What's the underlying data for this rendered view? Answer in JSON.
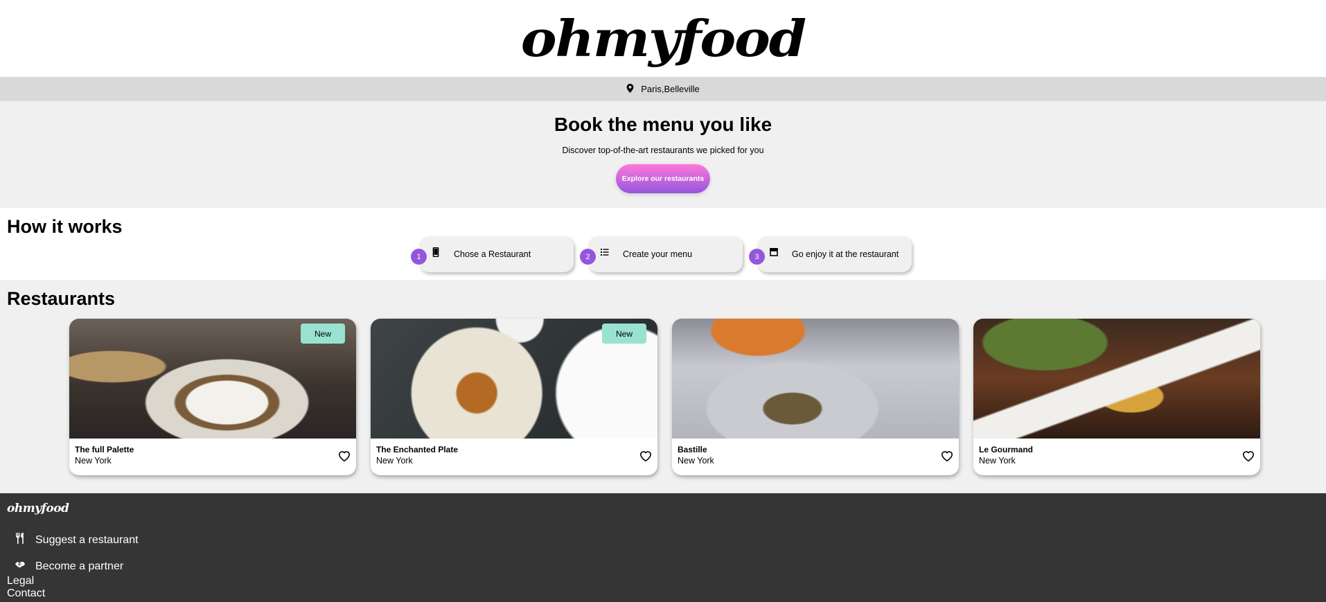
{
  "header": {
    "logo": "ohmyfood"
  },
  "location": {
    "icon": "map-pin-icon",
    "text": "Paris,Belleville"
  },
  "hero": {
    "title": "Book the menu you like",
    "subtitle": "Discover top-of-the-art restaurants we picked for you",
    "cta_label": "Explore our restaurants"
  },
  "how_it_works": {
    "title": "How it works",
    "steps": [
      {
        "number": "1",
        "icon": "smartphone-icon",
        "label": "Chose a Restaurant"
      },
      {
        "number": "2",
        "icon": "list-icon",
        "label": "Create your menu"
      },
      {
        "number": "3",
        "icon": "store-icon",
        "label": "Go enjoy it at the restaurant"
      }
    ]
  },
  "restaurants": {
    "title": "Restaurants",
    "items": [
      {
        "name": "The full Palette",
        "city": "New York",
        "badge": "New"
      },
      {
        "name": "The Enchanted Plate",
        "city": "New York",
        "badge": "New"
      },
      {
        "name": "Bastille",
        "city": "New York",
        "badge": ""
      },
      {
        "name": "Le Gourmand",
        "city": "New York",
        "badge": ""
      }
    ]
  },
  "footer": {
    "logo": "ohmyfood",
    "suggest": {
      "icon": "utensils-icon",
      "label": "Suggest a restaurant"
    },
    "partner": {
      "icon": "handshake-icon",
      "label": "Become a partner"
    },
    "legal": "Legal",
    "contact": "Contact"
  },
  "colors": {
    "accent_purple": "#9356dc",
    "accent_pink": "#ff79da",
    "badge_green": "#99e2d0",
    "footer_bg": "#353535",
    "section_grey": "#f0f0f0"
  }
}
